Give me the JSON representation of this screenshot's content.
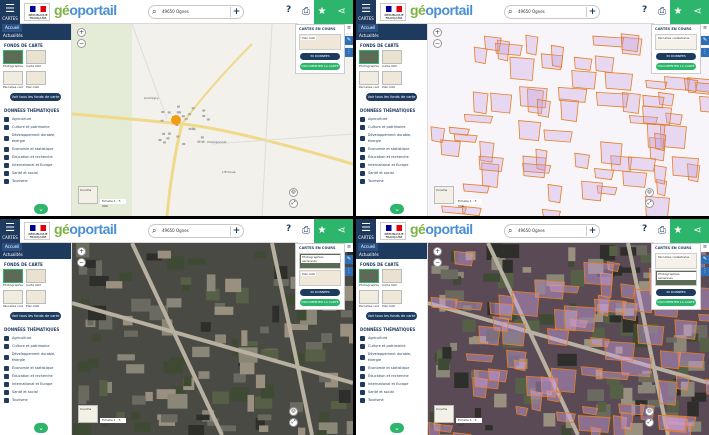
{
  "header": {
    "menu_label": "CARTES",
    "republic": "RÉPUBLIQUE FRANÇAISE",
    "logo_prefix": "gé",
    "logo_suffix": "oportail",
    "search_text": "49650 Ognes",
    "help": "?"
  },
  "sidebar": {
    "tab_home": "Accueil",
    "tab_news": "Actualités",
    "fonds_title": "FONDS DE CARTE",
    "fonds": [
      "Photographies aériennes",
      "Carte IGN",
      "Parcelles cadastrales",
      "Plan IGN"
    ],
    "voir_all": "Voir tous les fonds de carte",
    "themes_title": "DONNÉES THÉMATIQUES",
    "themes": [
      "Agriculture",
      "Culture et patrimoine",
      "Développement durable, énergie",
      "Économie et statistique",
      "Éducation et recherche",
      "International et Europe",
      "Santé et social",
      "Tourisme"
    ]
  },
  "carto": {
    "title": "CARTES EN COURS",
    "layer_labels": [
      "Parcelles cadastrales",
      "Photographies aériennes",
      "Plan IGN"
    ],
    "btn_donnees": "30 DONNÉES",
    "btn_documenter": "DOCUMENTER LA CARTE"
  },
  "map": {
    "scale": "Échelle 1 : 5 000",
    "minimap_label": "Couche",
    "places": [
      "Acomigny",
      "Champonnet",
      "L'Échoué"
    ]
  },
  "colors": {
    "navy": "#1e3a5f",
    "green": "#2db56b",
    "parcel": "#e67e22",
    "parcel_fill": "#c9a0dc"
  }
}
